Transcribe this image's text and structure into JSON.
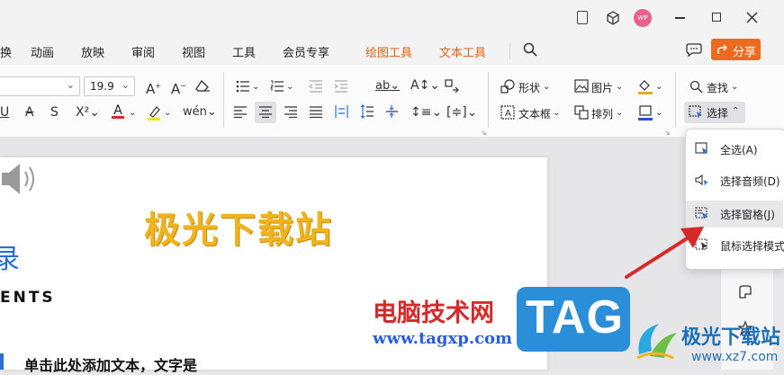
{
  "window": {
    "avatar_text": "WP",
    "controls": [
      "tablet-icon",
      "cube-icon",
      "minimize-icon",
      "maximize-icon",
      "close-icon"
    ]
  },
  "menu": {
    "items": [
      {
        "label": "换",
        "accent": false
      },
      {
        "label": "动画",
        "accent": false
      },
      {
        "label": "放映",
        "accent": false
      },
      {
        "label": "审阅",
        "accent": false
      },
      {
        "label": "视图",
        "accent": false
      },
      {
        "label": "工具",
        "accent": false
      },
      {
        "label": "会员专享",
        "accent": false
      },
      {
        "label": "绘图工具",
        "accent": true
      },
      {
        "label": "文本工具",
        "accent": true
      }
    ],
    "share_label": "分享"
  },
  "ribbon": {
    "font_size": "19.9",
    "shape_label": "形状",
    "textbox_label": "文本框",
    "picture_label": "图片",
    "arrange_label": "排列",
    "find_label": "查找",
    "select_label": "选择"
  },
  "select_menu": {
    "items": [
      {
        "label": "全选(A)",
        "icon": "select-all-icon"
      },
      {
        "label": "选择音频(D)",
        "icon": "audio-select-icon"
      },
      {
        "label": "选择窗格(J)",
        "icon": "selection-pane-icon"
      },
      {
        "label": "鼠标选择模式",
        "icon": "mouse-select-icon"
      }
    ]
  },
  "slide": {
    "title": "极光下载站",
    "partial_heading": "录",
    "contents_label": "ENTS",
    "body_text": "单击此处添加文本，文字是"
  },
  "watermark": {
    "cn_text": "电脑技术网",
    "tag_text": "TAG",
    "url": "www.tagxp.com",
    "logo_text": "极光下载站",
    "logo_url": "www.xz7.com"
  },
  "colors": {
    "accent_orange": "#ed6a1f",
    "title_gold": "#f0b41e",
    "tag_blue": "#2a8fd8",
    "arrow_red": "#d42a2a"
  }
}
